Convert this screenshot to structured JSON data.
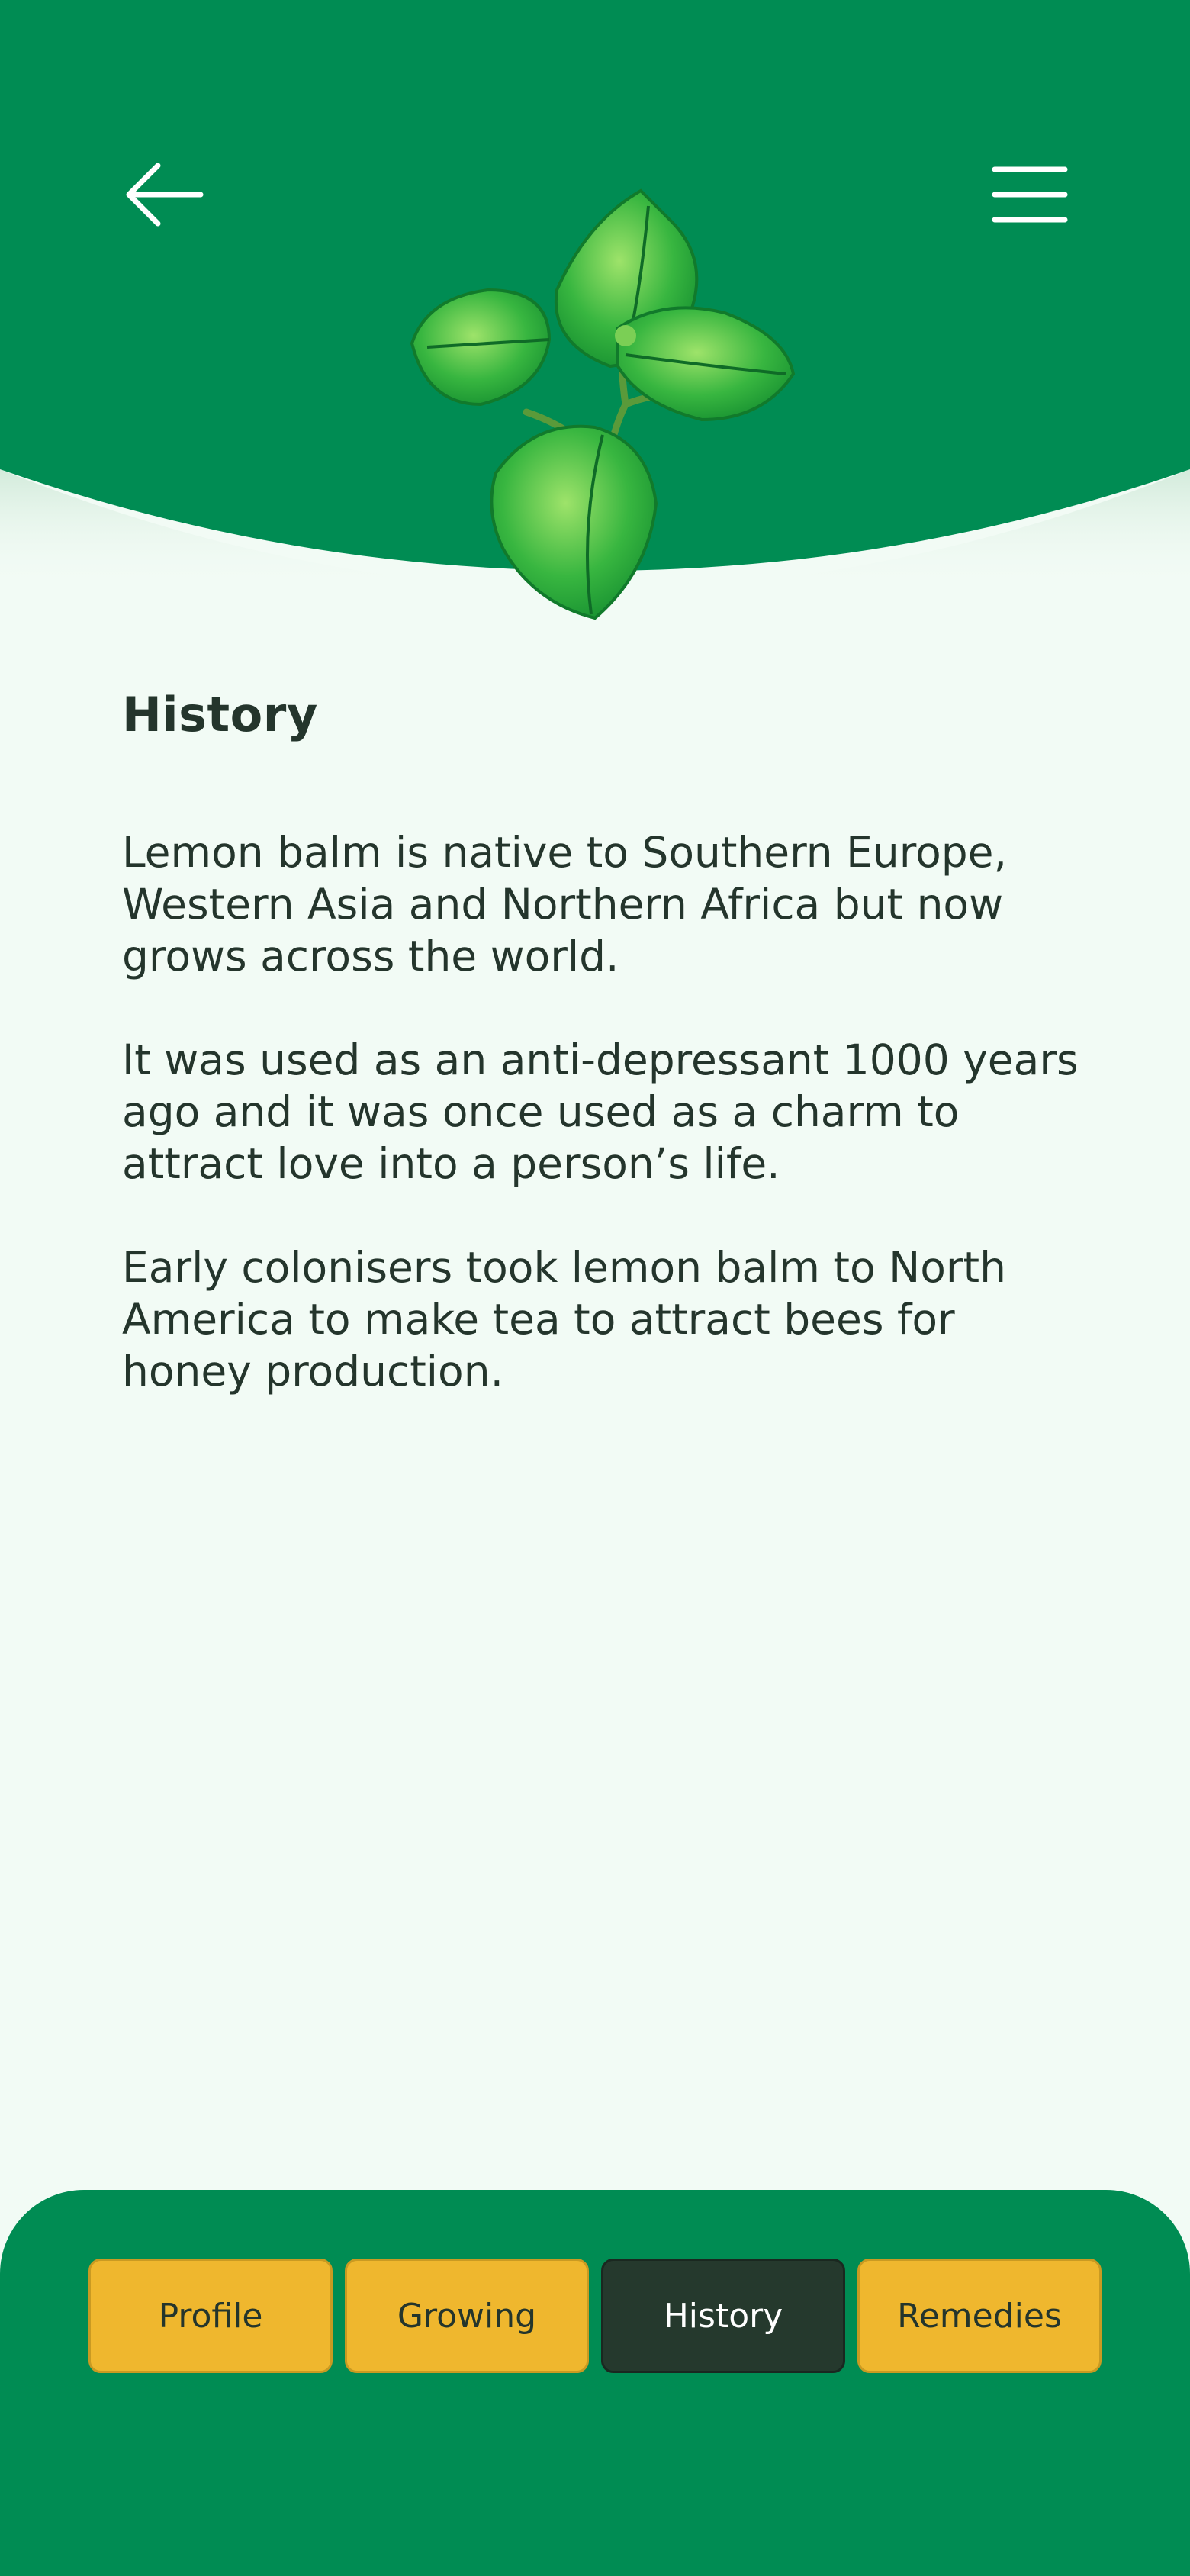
{
  "header": {
    "back_icon": "arrow-left-icon",
    "menu_icon": "hamburger-menu-icon",
    "plant_image": "lemon-balm-illustration",
    "brand_color": "#008c53"
  },
  "content": {
    "title": "History",
    "paragraphs": [
      "Lemon balm is native to Southern Europe, Western Asia and Northern Africa but now grows across the world.",
      "It was used as an anti-depressant 1000 years ago and it was once used as a charm to attract love into a person’s life.",
      "Early colonisers took lemon balm to North America to make tea to attract bees for honey production."
    ]
  },
  "tabs": [
    {
      "label": "Profile",
      "active": false
    },
    {
      "label": "Growing",
      "active": false
    },
    {
      "label": "History",
      "active": true
    },
    {
      "label": "Remedies",
      "active": false
    }
  ],
  "colors": {
    "tab_inactive": "#efb72e",
    "tab_active": "#25392d",
    "text": "#24352c",
    "background": "#f2fbf5"
  }
}
